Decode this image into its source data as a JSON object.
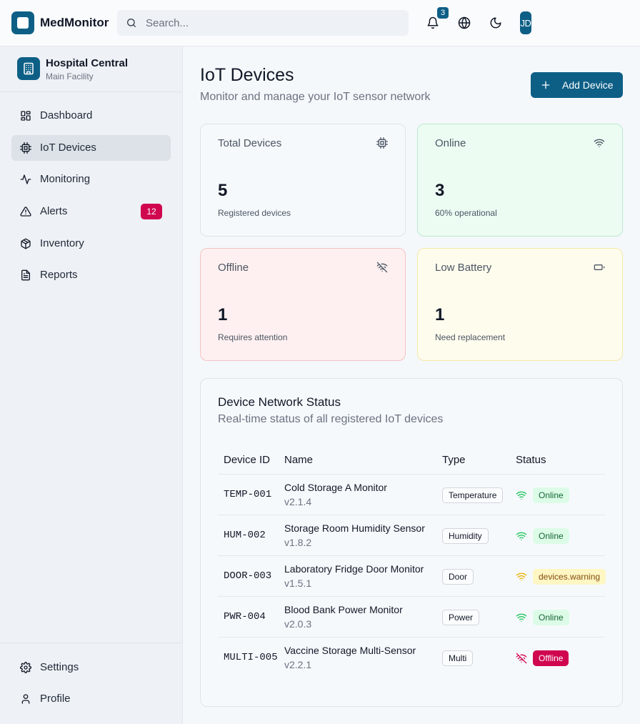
{
  "app": {
    "title": "MedMonitor"
  },
  "header": {
    "search_placeholder": "Search...",
    "notification_count": "3",
    "avatar_initials": "JD"
  },
  "sidebar": {
    "org_name": "Hospital Central",
    "org_sub": "Main Facility",
    "items": [
      {
        "label": "Dashboard",
        "icon": "dashboard-icon"
      },
      {
        "label": "IoT Devices",
        "icon": "chip-icon",
        "active": true
      },
      {
        "label": "Monitoring",
        "icon": "activity-icon"
      },
      {
        "label": "Alerts",
        "icon": "alert-triangle-icon",
        "badge": "12"
      },
      {
        "label": "Inventory",
        "icon": "package-icon"
      },
      {
        "label": "Reports",
        "icon": "file-text-icon"
      }
    ],
    "bottom_items": [
      {
        "label": "Settings",
        "icon": "gear-icon"
      },
      {
        "label": "Profile",
        "icon": "user-icon"
      }
    ]
  },
  "page": {
    "title": "IoT Devices",
    "subtitle": "Monitor and manage your IoT sensor network",
    "add_button": "Add Device"
  },
  "stats": [
    {
      "title": "Total Devices",
      "value": "5",
      "note": "Registered devices",
      "icon": "chip-icon"
    },
    {
      "title": "Online",
      "value": "3",
      "note": "60% operational",
      "icon": "wifi-icon"
    },
    {
      "title": "Offline",
      "value": "1",
      "note": "Requires attention",
      "icon": "wifi-off-icon"
    },
    {
      "title": "Low Battery",
      "value": "1",
      "note": "Need replacement",
      "icon": "battery-icon"
    }
  ],
  "table": {
    "title": "Device Network Status",
    "subtitle": "Real-time status of all registered IoT devices",
    "columns": [
      "Device ID",
      "Name",
      "Type",
      "Status"
    ],
    "rows": [
      {
        "id": "TEMP-001",
        "name": "Cold Storage A Monitor",
        "version": "v2.1.4",
        "type": "Temperature",
        "status": "Online"
      },
      {
        "id": "HUM-002",
        "name": "Storage Room Humidity Sensor",
        "version": "v1.8.2",
        "type": "Humidity",
        "status": "Online"
      },
      {
        "id": "DOOR-003",
        "name": "Laboratory Fridge Door Monitor",
        "version": "v1.5.1",
        "type": "Door",
        "status": "devices.warning"
      },
      {
        "id": "PWR-004",
        "name": "Blood Bank Power Monitor",
        "version": "v2.0.3",
        "type": "Power",
        "status": "Online"
      },
      {
        "id": "MULTI-005",
        "name": "Vaccine Storage Multi-Sensor",
        "version": "v2.2.1",
        "type": "Multi",
        "status": "Offline"
      }
    ]
  },
  "colors": {
    "brand": "#0e5f86",
    "online": "#22c55e",
    "warning": "#eab308",
    "offline": "#d0064f"
  }
}
